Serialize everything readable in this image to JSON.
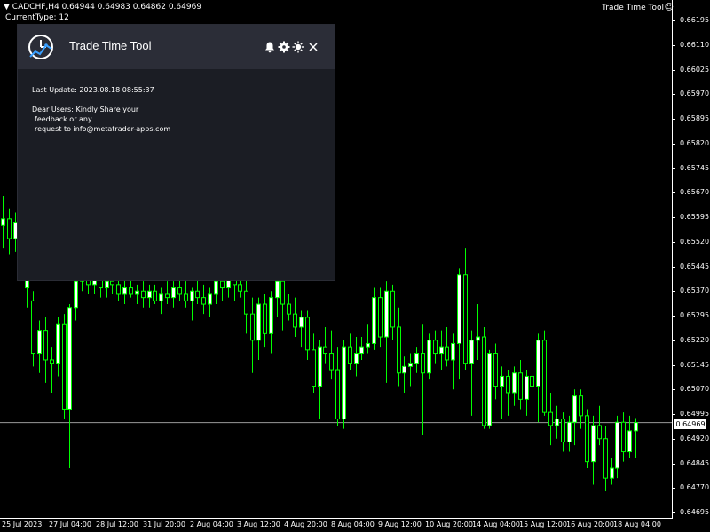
{
  "header": {
    "symbol_line": "▼ CADCHF,H4  0.64944 0.64983 0.64862 0.64969",
    "current_type": "CurrentType: 12",
    "tool_label": "Trade Time Tool",
    "smiley_icon": "smiley-icon"
  },
  "panel": {
    "title": "Trade Time Tool",
    "last_update": "Last Update: 2023.08.18 08:55:37",
    "message_lines": [
      "Dear Users: Kindly Share your",
      " feedback or any",
      " request to info@metatrader-apps.com"
    ],
    "icons": [
      "bell-icon",
      "gear-icon",
      "sun-icon",
      "close-icon"
    ]
  },
  "colors": {
    "bull": "#ffffff",
    "bear": "#000000",
    "wick": "#00ff00",
    "panel_bg": "#1b1d24",
    "panel_header_bg": "#2b2d37"
  },
  "chart_data": {
    "type": "candlestick",
    "symbol": "CADCHF",
    "timeframe": "H4",
    "ylim": [
      0.64695,
      0.66195
    ],
    "y_ticks": [
      "0.66195",
      "0.66110",
      "0.66025",
      "0.65970",
      "0.65895",
      "0.65820",
      "0.65745",
      "0.65670",
      "0.65595",
      "0.65520",
      "0.65445",
      "0.65370",
      "0.65295",
      "0.65220",
      "0.65145",
      "0.65070",
      "0.64995",
      "0.64920",
      "0.64845",
      "0.64770",
      "0.64695"
    ],
    "x_ticks": [
      "25 Jul 2023",
      "27 Jul 04:00",
      "28 Jul 12:00",
      "31 Jul 20:00",
      "2 Aug 04:00",
      "3 Aug 12:00",
      "4 Aug 20:00",
      "8 Aug 04:00",
      "9 Aug 12:00",
      "10 Aug 20:00",
      "14 Aug 04:00",
      "15 Aug 12:00",
      "16 Aug 20:00",
      "18 Aug 04:00"
    ],
    "current_price": "0.64969",
    "candles": [
      {
        "o": 0.6557,
        "h": 0.6566,
        "l": 0.655,
        "c": 0.6559
      },
      {
        "o": 0.6559,
        "h": 0.6562,
        "l": 0.6548,
        "c": 0.6553
      },
      {
        "o": 0.6553,
        "h": 0.6561,
        "l": 0.6549,
        "c": 0.6558
      },
      {
        "o": 0.6558,
        "h": 0.6562,
        "l": 0.6554,
        "c": 0.6556
      },
      {
        "o": 0.6538,
        "h": 0.6544,
        "l": 0.6532,
        "c": 0.6542
      },
      {
        "o": 0.6534,
        "h": 0.6537,
        "l": 0.6514,
        "c": 0.6518
      },
      {
        "o": 0.6518,
        "h": 0.6528,
        "l": 0.6512,
        "c": 0.6525
      },
      {
        "o": 0.6525,
        "h": 0.6529,
        "l": 0.6509,
        "c": 0.6516
      },
      {
        "o": 0.6516,
        "h": 0.652,
        "l": 0.6506,
        "c": 0.6515
      },
      {
        "o": 0.6515,
        "h": 0.6529,
        "l": 0.6511,
        "c": 0.6527
      },
      {
        "o": 0.6527,
        "h": 0.653,
        "l": 0.6498,
        "c": 0.6501
      },
      {
        "o": 0.6501,
        "h": 0.6533,
        "l": 0.6483,
        "c": 0.6532
      },
      {
        "o": 0.6532,
        "h": 0.6542,
        "l": 0.6528,
        "c": 0.654
      },
      {
        "o": 0.654,
        "h": 0.6546,
        "l": 0.6537,
        "c": 0.6542
      },
      {
        "o": 0.6542,
        "h": 0.6547,
        "l": 0.6536,
        "c": 0.6539
      },
      {
        "o": 0.6539,
        "h": 0.6545,
        "l": 0.6536,
        "c": 0.6541
      },
      {
        "o": 0.6541,
        "h": 0.6546,
        "l": 0.6535,
        "c": 0.6538
      },
      {
        "o": 0.6538,
        "h": 0.6542,
        "l": 0.6535,
        "c": 0.654
      },
      {
        "o": 0.654,
        "h": 0.6544,
        "l": 0.6536,
        "c": 0.6539
      },
      {
        "o": 0.6539,
        "h": 0.6542,
        "l": 0.6534,
        "c": 0.6536
      },
      {
        "o": 0.6536,
        "h": 0.6541,
        "l": 0.6533,
        "c": 0.6538
      },
      {
        "o": 0.6538,
        "h": 0.6541,
        "l": 0.6535,
        "c": 0.6536
      },
      {
        "o": 0.6536,
        "h": 0.6539,
        "l": 0.6533,
        "c": 0.6537
      },
      {
        "o": 0.6537,
        "h": 0.654,
        "l": 0.6532,
        "c": 0.6535
      },
      {
        "o": 0.6535,
        "h": 0.6539,
        "l": 0.6532,
        "c": 0.6537
      },
      {
        "o": 0.6537,
        "h": 0.6539,
        "l": 0.6533,
        "c": 0.6534
      },
      {
        "o": 0.6534,
        "h": 0.6538,
        "l": 0.653,
        "c": 0.6536
      },
      {
        "o": 0.6536,
        "h": 0.654,
        "l": 0.6533,
        "c": 0.6535
      },
      {
        "o": 0.6535,
        "h": 0.654,
        "l": 0.6532,
        "c": 0.6538
      },
      {
        "o": 0.6538,
        "h": 0.6541,
        "l": 0.6534,
        "c": 0.6536
      },
      {
        "o": 0.6536,
        "h": 0.654,
        "l": 0.6532,
        "c": 0.6534
      },
      {
        "o": 0.6534,
        "h": 0.6538,
        "l": 0.6528,
        "c": 0.6537
      },
      {
        "o": 0.6537,
        "h": 0.6541,
        "l": 0.6533,
        "c": 0.6535
      },
      {
        "o": 0.6535,
        "h": 0.6539,
        "l": 0.653,
        "c": 0.6533
      },
      {
        "o": 0.6533,
        "h": 0.6538,
        "l": 0.6529,
        "c": 0.6536
      },
      {
        "o": 0.6536,
        "h": 0.6542,
        "l": 0.6533,
        "c": 0.654
      },
      {
        "o": 0.654,
        "h": 0.6544,
        "l": 0.6534,
        "c": 0.6538
      },
      {
        "o": 0.6538,
        "h": 0.6547,
        "l": 0.6535,
        "c": 0.6541
      },
      {
        "o": 0.6541,
        "h": 0.6545,
        "l": 0.6534,
        "c": 0.6539
      },
      {
        "o": 0.6539,
        "h": 0.6542,
        "l": 0.6535,
        "c": 0.6537
      },
      {
        "o": 0.6537,
        "h": 0.6543,
        "l": 0.6524,
        "c": 0.653
      },
      {
        "o": 0.653,
        "h": 0.6535,
        "l": 0.6512,
        "c": 0.6522
      },
      {
        "o": 0.6522,
        "h": 0.6535,
        "l": 0.6516,
        "c": 0.6533
      },
      {
        "o": 0.6533,
        "h": 0.6536,
        "l": 0.652,
        "c": 0.6524
      },
      {
        "o": 0.6524,
        "h": 0.6537,
        "l": 0.6518,
        "c": 0.6535
      },
      {
        "o": 0.6535,
        "h": 0.6543,
        "l": 0.6529,
        "c": 0.654
      },
      {
        "o": 0.654,
        "h": 0.6542,
        "l": 0.6525,
        "c": 0.6533
      },
      {
        "o": 0.6533,
        "h": 0.6536,
        "l": 0.6528,
        "c": 0.653
      },
      {
        "o": 0.653,
        "h": 0.6535,
        "l": 0.6523,
        "c": 0.6526
      },
      {
        "o": 0.6526,
        "h": 0.6531,
        "l": 0.652,
        "c": 0.6529
      },
      {
        "o": 0.6529,
        "h": 0.6531,
        "l": 0.6516,
        "c": 0.6519
      },
      {
        "o": 0.6519,
        "h": 0.6524,
        "l": 0.6506,
        "c": 0.6508
      },
      {
        "o": 0.6508,
        "h": 0.6522,
        "l": 0.6498,
        "c": 0.652
      },
      {
        "o": 0.652,
        "h": 0.6526,
        "l": 0.6515,
        "c": 0.6518
      },
      {
        "o": 0.6518,
        "h": 0.6525,
        "l": 0.651,
        "c": 0.6513
      },
      {
        "o": 0.6513,
        "h": 0.652,
        "l": 0.6496,
        "c": 0.6498
      },
      {
        "o": 0.6498,
        "h": 0.6522,
        "l": 0.6495,
        "c": 0.652
      },
      {
        "o": 0.652,
        "h": 0.6524,
        "l": 0.6513,
        "c": 0.6515
      },
      {
        "o": 0.6515,
        "h": 0.6523,
        "l": 0.6511,
        "c": 0.6518
      },
      {
        "o": 0.6518,
        "h": 0.6523,
        "l": 0.6516,
        "c": 0.652
      },
      {
        "o": 0.652,
        "h": 0.6527,
        "l": 0.6518,
        "c": 0.6521
      },
      {
        "o": 0.6521,
        "h": 0.6538,
        "l": 0.6519,
        "c": 0.6535
      },
      {
        "o": 0.6535,
        "h": 0.6538,
        "l": 0.652,
        "c": 0.6523
      },
      {
        "o": 0.6523,
        "h": 0.654,
        "l": 0.6509,
        "c": 0.6537
      },
      {
        "o": 0.6537,
        "h": 0.6539,
        "l": 0.6522,
        "c": 0.6526
      },
      {
        "o": 0.6526,
        "h": 0.6532,
        "l": 0.6508,
        "c": 0.6512
      },
      {
        "o": 0.6512,
        "h": 0.6517,
        "l": 0.6506,
        "c": 0.6514
      },
      {
        "o": 0.6514,
        "h": 0.6518,
        "l": 0.6508,
        "c": 0.6515
      },
      {
        "o": 0.6515,
        "h": 0.652,
        "l": 0.6512,
        "c": 0.6518
      },
      {
        "o": 0.6518,
        "h": 0.6527,
        "l": 0.6493,
        "c": 0.6512
      },
      {
        "o": 0.6512,
        "h": 0.6524,
        "l": 0.651,
        "c": 0.6522
      },
      {
        "o": 0.6522,
        "h": 0.6525,
        "l": 0.6515,
        "c": 0.6518
      },
      {
        "o": 0.6518,
        "h": 0.6525,
        "l": 0.6513,
        "c": 0.652
      },
      {
        "o": 0.652,
        "h": 0.6526,
        "l": 0.6514,
        "c": 0.6516
      },
      {
        "o": 0.6516,
        "h": 0.6524,
        "l": 0.6507,
        "c": 0.6521
      },
      {
        "o": 0.6521,
        "h": 0.6544,
        "l": 0.651,
        "c": 0.6542
      },
      {
        "o": 0.6542,
        "h": 0.655,
        "l": 0.6513,
        "c": 0.6515
      },
      {
        "o": 0.6515,
        "h": 0.6525,
        "l": 0.6499,
        "c": 0.6522
      },
      {
        "o": 0.6522,
        "h": 0.6533,
        "l": 0.6516,
        "c": 0.6523
      },
      {
        "o": 0.6523,
        "h": 0.6526,
        "l": 0.6495,
        "c": 0.6496
      },
      {
        "o": 0.6496,
        "h": 0.6519,
        "l": 0.6495,
        "c": 0.6518
      },
      {
        "o": 0.6518,
        "h": 0.6521,
        "l": 0.6504,
        "c": 0.6508
      },
      {
        "o": 0.6508,
        "h": 0.6514,
        "l": 0.6498,
        "c": 0.6511
      },
      {
        "o": 0.6511,
        "h": 0.6513,
        "l": 0.6499,
        "c": 0.6506
      },
      {
        "o": 0.6506,
        "h": 0.6514,
        "l": 0.6502,
        "c": 0.6512
      },
      {
        "o": 0.6512,
        "h": 0.6516,
        "l": 0.6501,
        "c": 0.6504
      },
      {
        "o": 0.6504,
        "h": 0.6513,
        "l": 0.6499,
        "c": 0.6511
      },
      {
        "o": 0.6511,
        "h": 0.652,
        "l": 0.6503,
        "c": 0.6508
      },
      {
        "o": 0.6508,
        "h": 0.6524,
        "l": 0.6497,
        "c": 0.6522
      },
      {
        "o": 0.6522,
        "h": 0.6525,
        "l": 0.6499,
        "c": 0.65
      },
      {
        "o": 0.65,
        "h": 0.6506,
        "l": 0.649,
        "c": 0.6496
      },
      {
        "o": 0.6496,
        "h": 0.6502,
        "l": 0.6492,
        "c": 0.6498
      },
      {
        "o": 0.6498,
        "h": 0.65,
        "l": 0.6488,
        "c": 0.6491
      },
      {
        "o": 0.6491,
        "h": 0.6499,
        "l": 0.6488,
        "c": 0.6497
      },
      {
        "o": 0.6497,
        "h": 0.6507,
        "l": 0.649,
        "c": 0.6505
      },
      {
        "o": 0.6505,
        "h": 0.6507,
        "l": 0.6495,
        "c": 0.6499
      },
      {
        "o": 0.6499,
        "h": 0.6501,
        "l": 0.6483,
        "c": 0.6485
      },
      {
        "o": 0.6485,
        "h": 0.6499,
        "l": 0.6478,
        "c": 0.6496
      },
      {
        "o": 0.6496,
        "h": 0.6502,
        "l": 0.649,
        "c": 0.6492
      },
      {
        "o": 0.6492,
        "h": 0.6496,
        "l": 0.6476,
        "c": 0.648
      },
      {
        "o": 0.648,
        "h": 0.6486,
        "l": 0.6478,
        "c": 0.6483
      },
      {
        "o": 0.6483,
        "h": 0.6499,
        "l": 0.648,
        "c": 0.6497
      },
      {
        "o": 0.6497,
        "h": 0.65,
        "l": 0.6485,
        "c": 0.6488
      },
      {
        "o": 0.6488,
        "h": 0.6499,
        "l": 0.6486,
        "c": 0.64944
      },
      {
        "o": 0.64944,
        "h": 0.64983,
        "l": 0.64862,
        "c": 0.64969
      }
    ]
  }
}
